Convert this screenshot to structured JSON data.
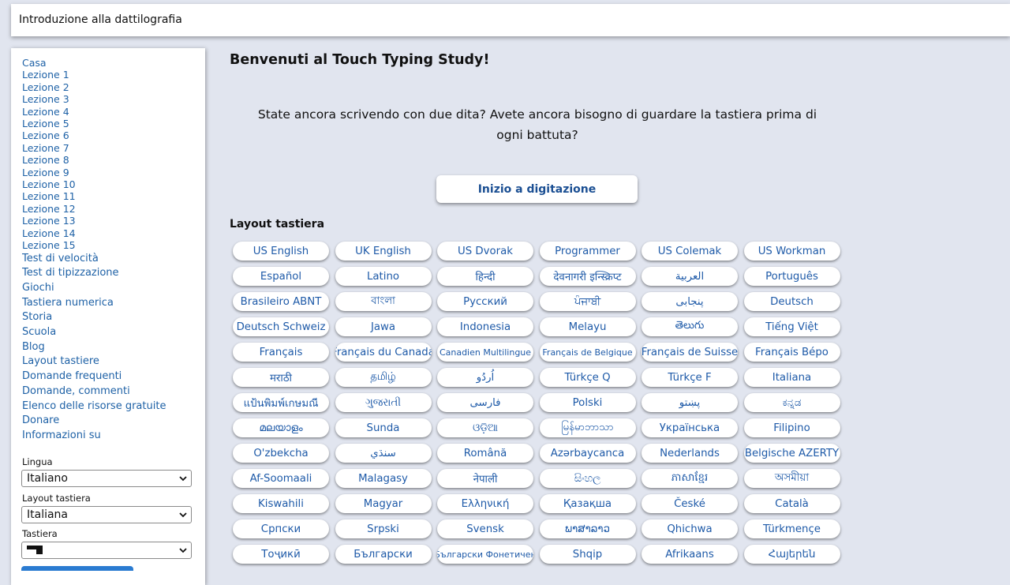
{
  "header": {
    "title": "Introduzione alla dattilografia"
  },
  "sidebar": {
    "nav": [
      "Casa",
      "Lezione 1",
      "Lezione 2",
      "Lezione 3",
      "Lezione 4",
      "Lezione 5",
      "Lezione 6",
      "Lezione 7",
      "Lezione 8",
      "Lezione 9",
      "Lezione 10",
      "Lezione 11",
      "Lezione 12",
      "Lezione 13",
      "Lezione 14",
      "Lezione 15",
      "Test di velocità",
      "Test di tipizzazione",
      "Giochi",
      "Tastiera numerica",
      "Storia",
      "Scuola",
      "Blog",
      "Layout tastiere",
      "Domande frequenti",
      "Domande, commenti",
      "Elenco delle risorse gratuite",
      "Donare",
      "Informazioni su"
    ],
    "language": {
      "label": "Lingua",
      "value": "Italiano"
    },
    "layout": {
      "label": "Layout tastiera",
      "value": "Italiana"
    },
    "keyboard": {
      "label": "Tastiera",
      "icon": "keyboard-shape-icon"
    }
  },
  "main": {
    "heading": "Benvenuti al Touch Typing Study!",
    "intro": "State ancora scrivendo con due dita? Avete ancora bisogno di guardare la tastiera prima di ogni battuta?",
    "start_button": "Inizio a digitazione",
    "layouts_title": "Layout tastiera",
    "layouts": [
      "US English",
      "UK English",
      "US Dvorak",
      "Programmer",
      "US Colemak",
      "US Workman",
      "Español",
      "Latino",
      "हिन्दी",
      "देवनागरी इन्स्क्रिप्ट",
      "العربية",
      "Português",
      "Brasileiro ABNT",
      "বাংলা",
      "Русский",
      "ਪੰਜਾਬੀ",
      "پنجابی",
      "Deutsch",
      "Deutsch Schweiz",
      "Jawa",
      "Indonesia",
      "Melayu",
      "తెలుగు",
      "Tiếng Việt",
      "Français",
      "Français du Canada",
      "Canadien Multilingue",
      "Français de Belgique",
      "Français de Suisse",
      "Français Bépo",
      "मराठी",
      "தமிழ்",
      "اُردُو",
      "Türkçe Q",
      "Türkçe F",
      "Italiana",
      "แป้นพิมพ์เกษมณี",
      "ગુજરાતી",
      "فارسی",
      "Polski",
      "پښتو",
      "ಕನ್ನಡ",
      "മലയാളം",
      "Sunda",
      "ଓଡ଼ିଆ",
      "မြန်မာဘာသာ",
      "Українська",
      "Filipino",
      "O'zbekcha",
      "سنڌي",
      "Română",
      "Azərbaycanca",
      "Nederlands",
      "Belgische AZERTY",
      "Af-Soomaali",
      "Malagasy",
      "नेपाली",
      "සිංහල",
      "ភាសាខ្មែរ",
      "অসমীয়া",
      "Kiswahili",
      "Magyar",
      "Ελληνική",
      "Қазақша",
      "České",
      "Català",
      "Српски",
      "Srpski",
      "Svensk",
      "ພາສາລາວ",
      "Qhichwa",
      "Türkmençe",
      "Тоҷикӣ",
      "Български",
      "Български Фонетичен",
      "Shqip",
      "Afrikaans",
      "Հայերեն"
    ],
    "small_layouts": [
      "Canadien Multilingue",
      "Français de Belgique",
      "Български Фонетичен"
    ]
  },
  "colors": {
    "link": "#1e61a6",
    "background": "#e1e5ef",
    "button_text": "#1b4f93"
  }
}
